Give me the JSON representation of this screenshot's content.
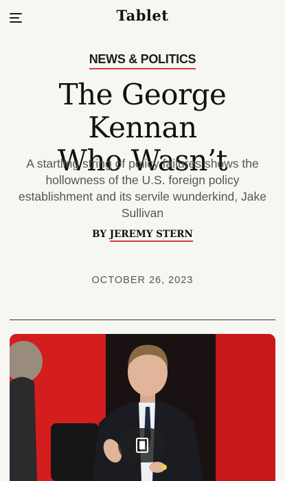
{
  "header": {
    "logo": "Tablet",
    "menu_icon": "hamburger-menu-icon"
  },
  "article": {
    "section": "NEWS & POLITICS",
    "headline_line1": "The George Kennan",
    "headline_line2": "Who Wasn’t",
    "dek": "A startling string of policy failures shows the hollowness of the U.S. foreign policy establishment and its servile wunderkind, Jake Sullivan",
    "byline_prefix": "BY",
    "author": "JEREMY STERN",
    "date": "OCTOBER 26, 2023"
  },
  "colors": {
    "background": "#f6f6f2",
    "accent": "#d9393a",
    "hero_red": "#d21c1c"
  },
  "reader_button": {
    "icon": "reader-mode-icon"
  }
}
